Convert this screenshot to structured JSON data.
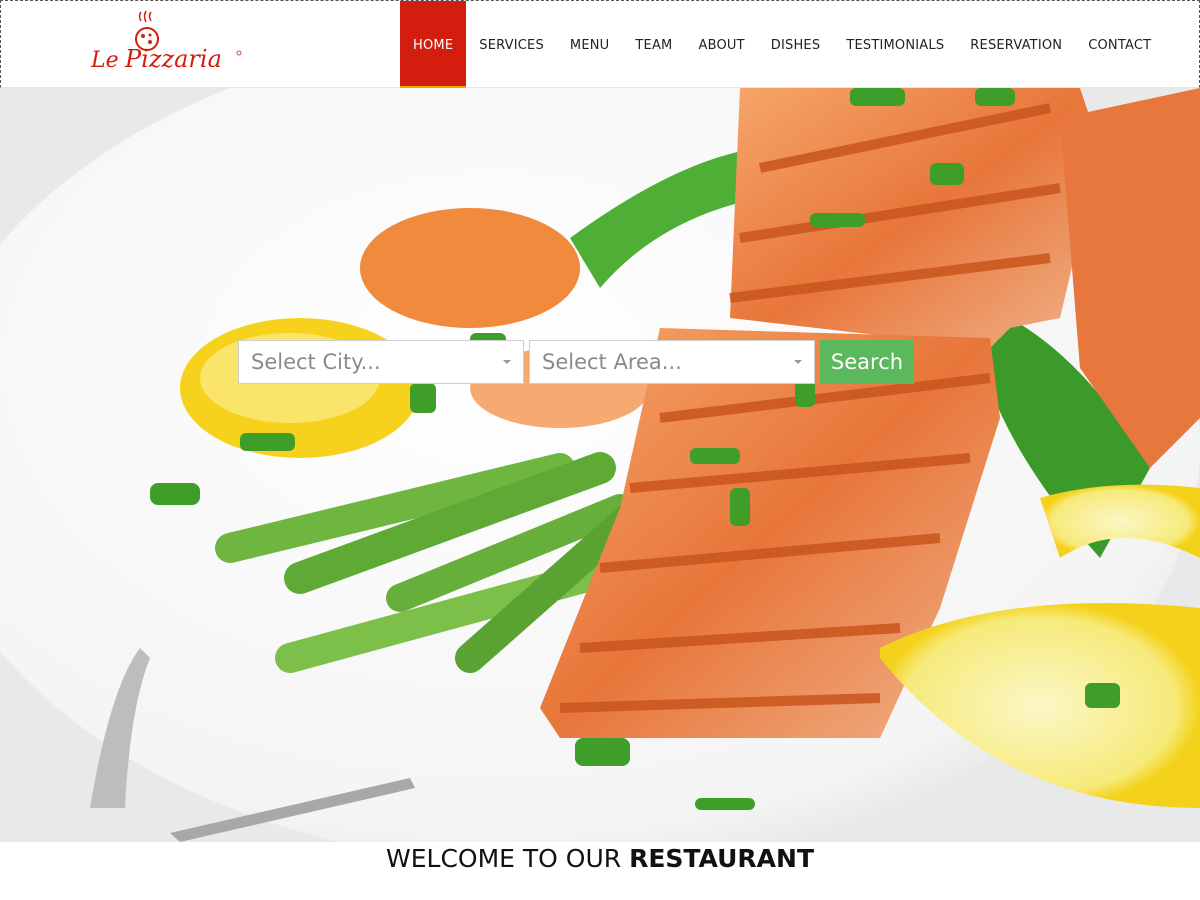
{
  "brand": {
    "logo_text": "Le Pizzaria",
    "logo_color": "#d31d0f"
  },
  "nav": {
    "items": [
      {
        "label": "HOME",
        "active": true
      },
      {
        "label": "SERVICES"
      },
      {
        "label": "MENU"
      },
      {
        "label": "TEAM"
      },
      {
        "label": "ABOUT"
      },
      {
        "label": "DISHES"
      },
      {
        "label": "TESTIMONIALS"
      },
      {
        "label": "RESERVATION"
      },
      {
        "label": "CONTACT"
      }
    ],
    "active_color": "#d31d0f",
    "active_underline_color": "#f2a900"
  },
  "hero": {
    "image_icon": "grilled-salmon-dish-photo",
    "search": {
      "city_placeholder": "Select City...",
      "area_placeholder": "Select Area...",
      "button_label": "Search",
      "button_color": "#5cb85c"
    }
  },
  "welcome": {
    "prefix": "WELCOME TO OUR ",
    "emphasis": "RESTAURANT"
  }
}
